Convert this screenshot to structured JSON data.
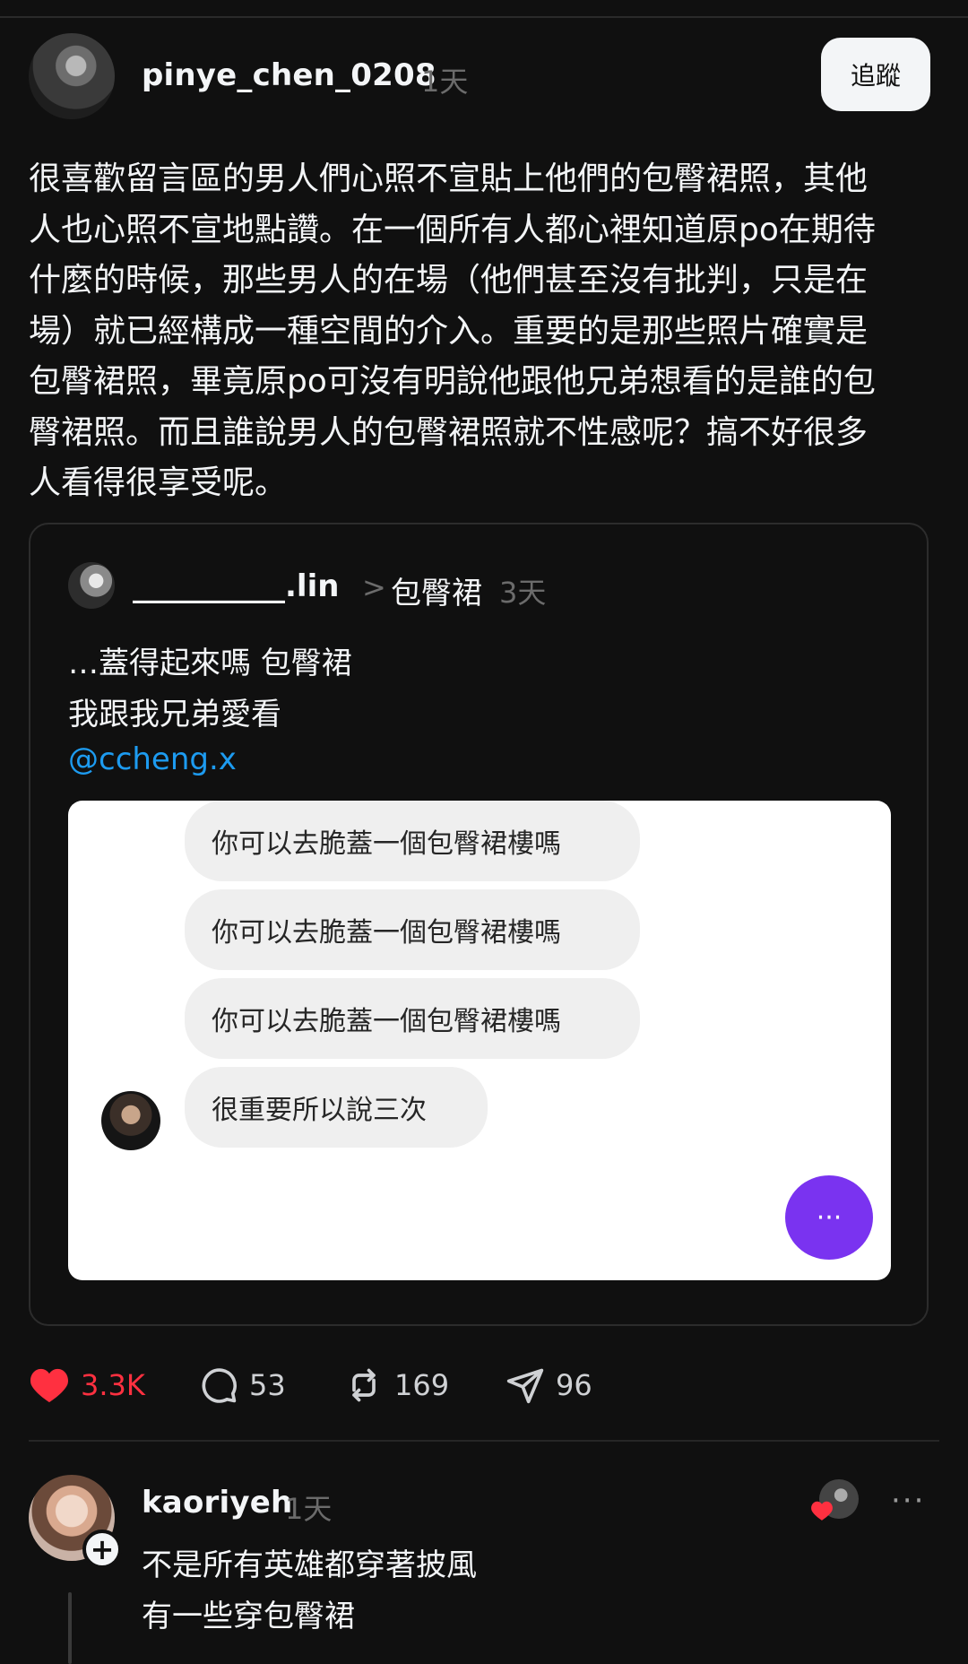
{
  "post": {
    "username": "pinye_chen_0208",
    "time": "1天",
    "follow_label": "追蹤",
    "text": "很喜歡留言區的男人們心照不宣貼上他們的包臀裙照，其他\n人也心照不宣地點讚。在一個所有人都心裡知道原po在期待\n什麼的時候，那些男人的在場（他們甚至沒有批判，只是在\n場）就已經構成一種空間的介入。重要的是那些照片確實是\n包臀裙照，畢竟原po可沒有明說他跟他兄弟想看的是誰的包\n臀裙照。而且誰說男人的包臀裙照就不性感呢？搞不好很多\n人看得很享受呢。"
  },
  "quote": {
    "username": "__________.lin",
    "arrow": ">",
    "topic": "包臀裙",
    "time": "3天",
    "lines": [
      "…蓋得起來嗎 包臀裙",
      "我跟我兄弟愛看"
    ],
    "mention": "@ccheng.x"
  },
  "chat": {
    "messages": [
      "你可以去脆蓋一個包臀裙樓嗎",
      "你可以去脆蓋一個包臀裙樓嗎",
      "你可以去脆蓋一個包臀裙樓嗎",
      "很重要所以說三次"
    ],
    "fab_label": "···"
  },
  "actions": {
    "likes": "3.3K",
    "comments": "53",
    "reposts": "169",
    "shares": "96"
  },
  "reply": {
    "username": "kaoriyeh",
    "time": "1天",
    "lines": [
      "不是所有英雄都穿著披風",
      "有一些穿包臀裙"
    ],
    "plus": "+",
    "more": "···"
  },
  "colors": {
    "background": "#101010",
    "like_red": "#ff3040",
    "mention_blue": "#1d9bf0",
    "fab_purple": "#7a33f0"
  }
}
